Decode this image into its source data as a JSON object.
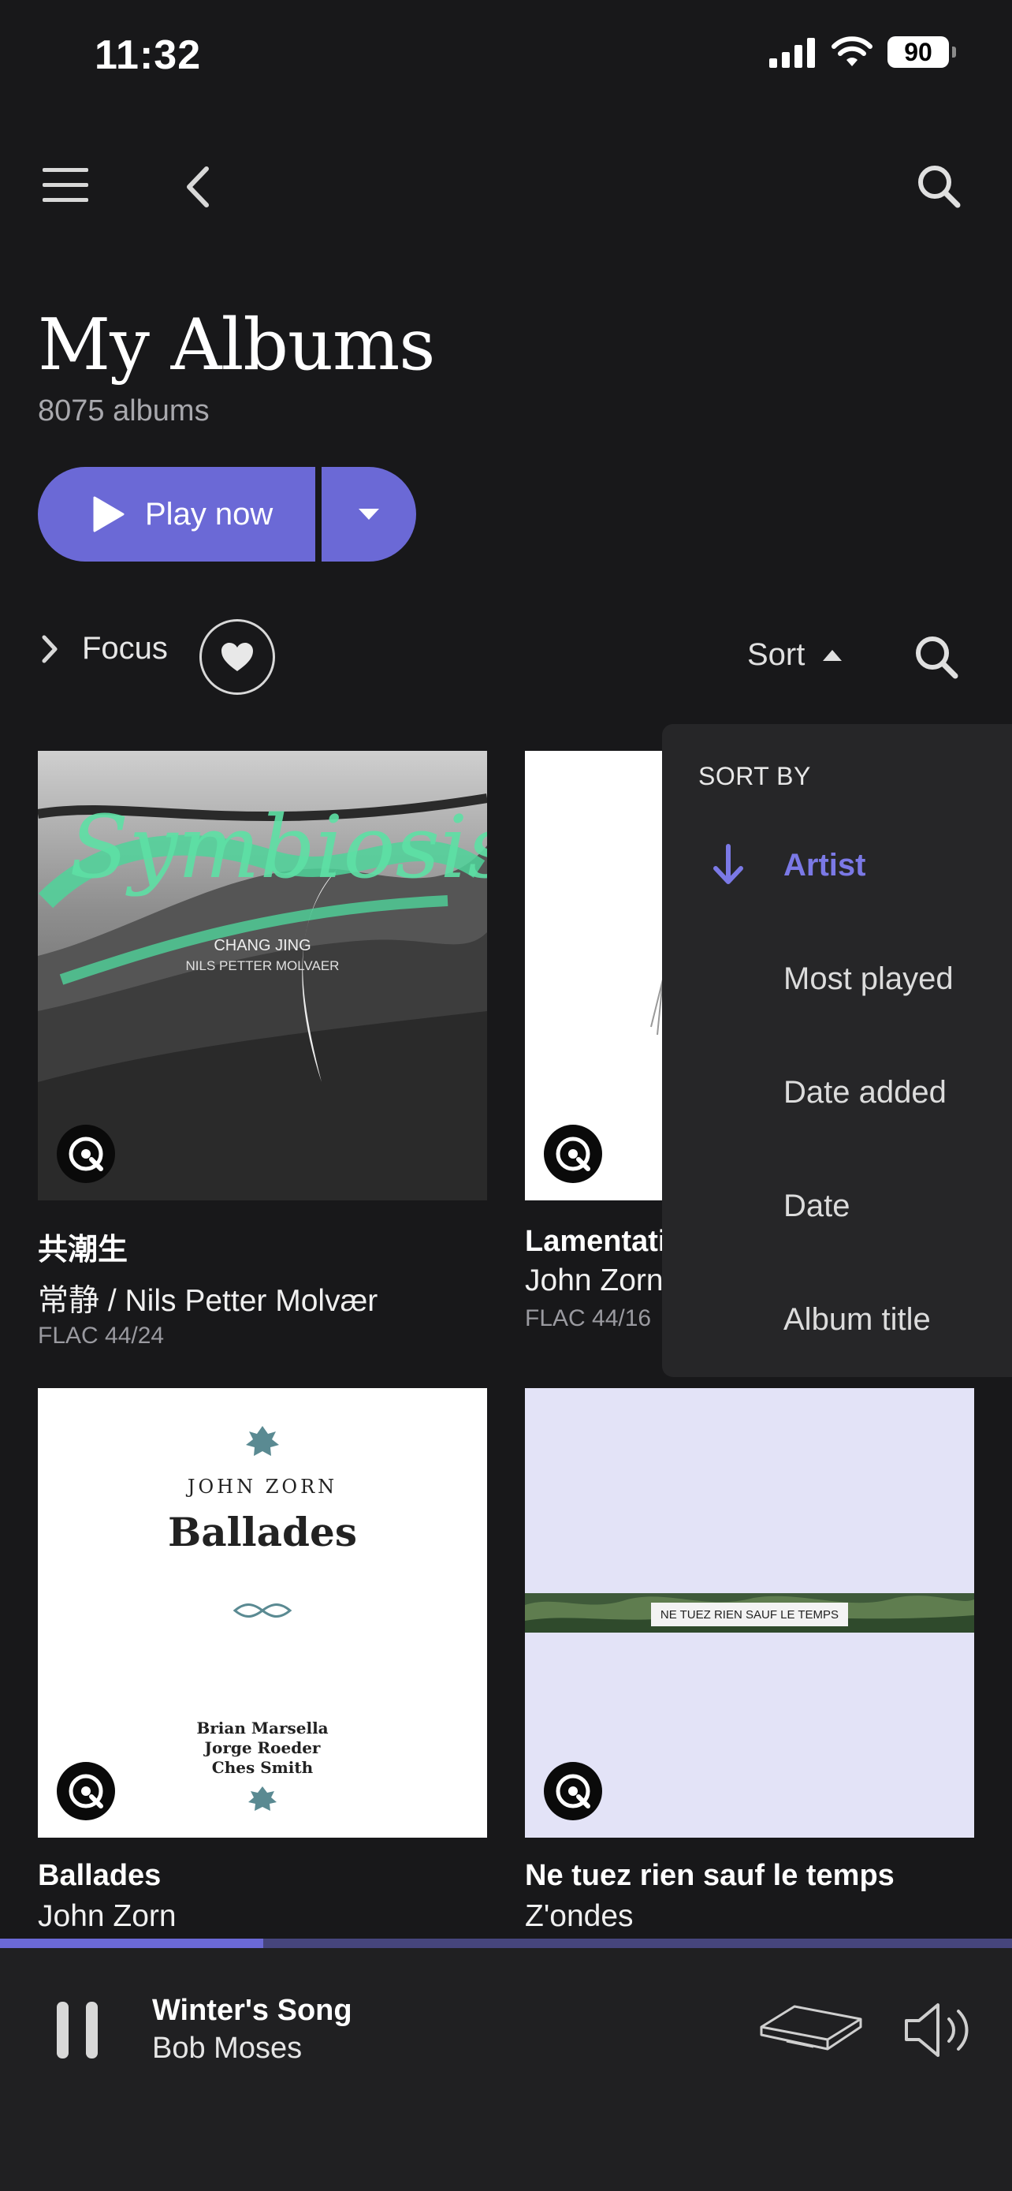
{
  "status_bar": {
    "time": "11:32",
    "battery": "90"
  },
  "header": {
    "title": "My Albums",
    "count": "8075 albums"
  },
  "actions": {
    "play_label": "Play now"
  },
  "filters": {
    "focus_label": "Focus",
    "sort_label": "Sort"
  },
  "sort_menu": {
    "heading": "SORT BY",
    "items": [
      "Artist",
      "Most played",
      "Date added",
      "Date",
      "Album title"
    ],
    "selected": "Artist"
  },
  "albums": [
    {
      "title": "共潮生",
      "artist": "常静 / Nils Petter Molvær",
      "format": "FLAC 44/24",
      "cover_text": {
        "script": "Symbiosis",
        "line1": "CHANG JING",
        "line2": "NILS PETTER MOLVAER"
      }
    },
    {
      "title": "Lamentati",
      "artist": "John Zorn",
      "format": "FLAC 44/16"
    },
    {
      "title": "Ballades",
      "artist": "John Zorn",
      "cover_text": {
        "top": "JOHN ZORN",
        "main": "Ballades",
        "p1": "Brian Marsella",
        "p2": "Jorge Roeder",
        "p3": "Ches Smith"
      }
    },
    {
      "title": "Ne tuez rien sauf le temps",
      "artist": "Z'ondes",
      "cover_text": {
        "banner": "NE TUEZ RIEN SAUF LE TEMPS"
      }
    }
  ],
  "now_playing": {
    "title": "Winter's Song",
    "artist": "Bob Moses",
    "progress": 0.26
  },
  "colors": {
    "accent": "#6b69d6",
    "background": "#18181a",
    "menu": "#262628",
    "player": "#202022"
  }
}
